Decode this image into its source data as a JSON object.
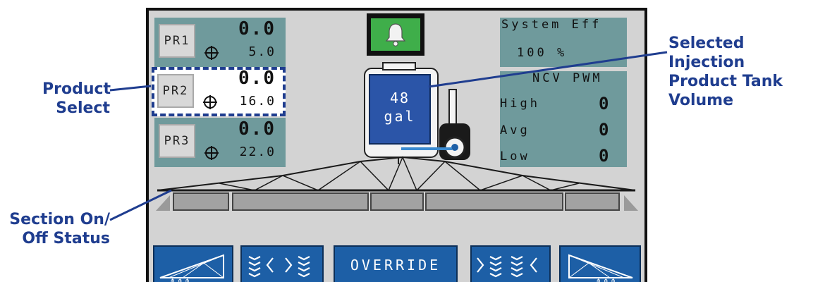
{
  "callouts": {
    "product_select": [
      "Product",
      "Select"
    ],
    "tank_volume": [
      "Selected Injection",
      "Product Tank",
      "Volume"
    ],
    "section_status": [
      "Section On/",
      "Off Status"
    ]
  },
  "products": [
    {
      "label": "PR1",
      "rate": "0.0",
      "target": "5.0",
      "selected": false
    },
    {
      "label": "PR2",
      "rate": "0.0",
      "target": "16.0",
      "selected": true
    },
    {
      "label": "PR3",
      "rate": "0.0",
      "target": "22.0",
      "selected": false
    }
  ],
  "system_eff": {
    "label": "System Eff",
    "value": "100 %"
  },
  "ncv_pwm": {
    "title": "NCV PWM",
    "rows": [
      {
        "label": "High",
        "value": "0"
      },
      {
        "label": "Avg",
        "value": "0"
      },
      {
        "label": "Low",
        "value": "0"
      }
    ]
  },
  "tank": {
    "amount": "48",
    "unit": "gal"
  },
  "footer": {
    "override_label": "OVERRIDE"
  },
  "colors": {
    "screen_bg": "#d3d3d3",
    "panel_teal": "#6f9a9c",
    "selection_border": "#1f3d8f",
    "alarm_green": "#3fae4a",
    "button_blue": "#1d5fa6",
    "tank_blue": "#2b55a8",
    "callout_text": "#1f3d8f"
  },
  "icons": [
    "bell-icon",
    "target-icon",
    "boom-left-icon",
    "boom-right-icon",
    "shift-left-icon",
    "shift-right-icon"
  ]
}
